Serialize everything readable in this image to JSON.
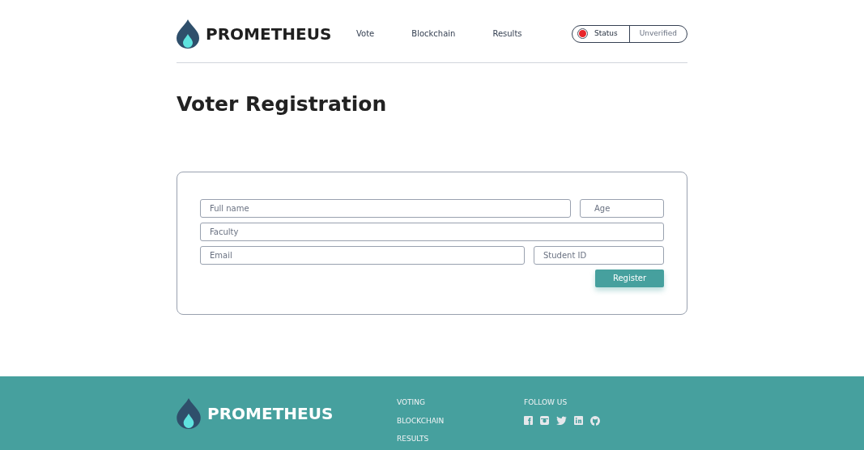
{
  "header": {
    "brand": "PROMETHEUS",
    "nav": [
      "Vote",
      "Blockchain",
      "Results"
    ],
    "status": {
      "label": "Status",
      "value": "Unverified",
      "verified": false
    }
  },
  "title": "Voter Registration",
  "form": {
    "fields": [
      {
        "placeholder": "Full name"
      },
      {
        "placeholder": "Age"
      },
      {
        "placeholder": "Faculty"
      },
      {
        "placeholder": "Email"
      },
      {
        "placeholder": "Student ID"
      }
    ],
    "submit": "Register"
  },
  "footer": {
    "brand": "PROMETHEUS",
    "links": [
      "VOTING",
      "BLOCKCHAIN",
      "RESULTS"
    ],
    "follow": "FOLLOW US"
  }
}
